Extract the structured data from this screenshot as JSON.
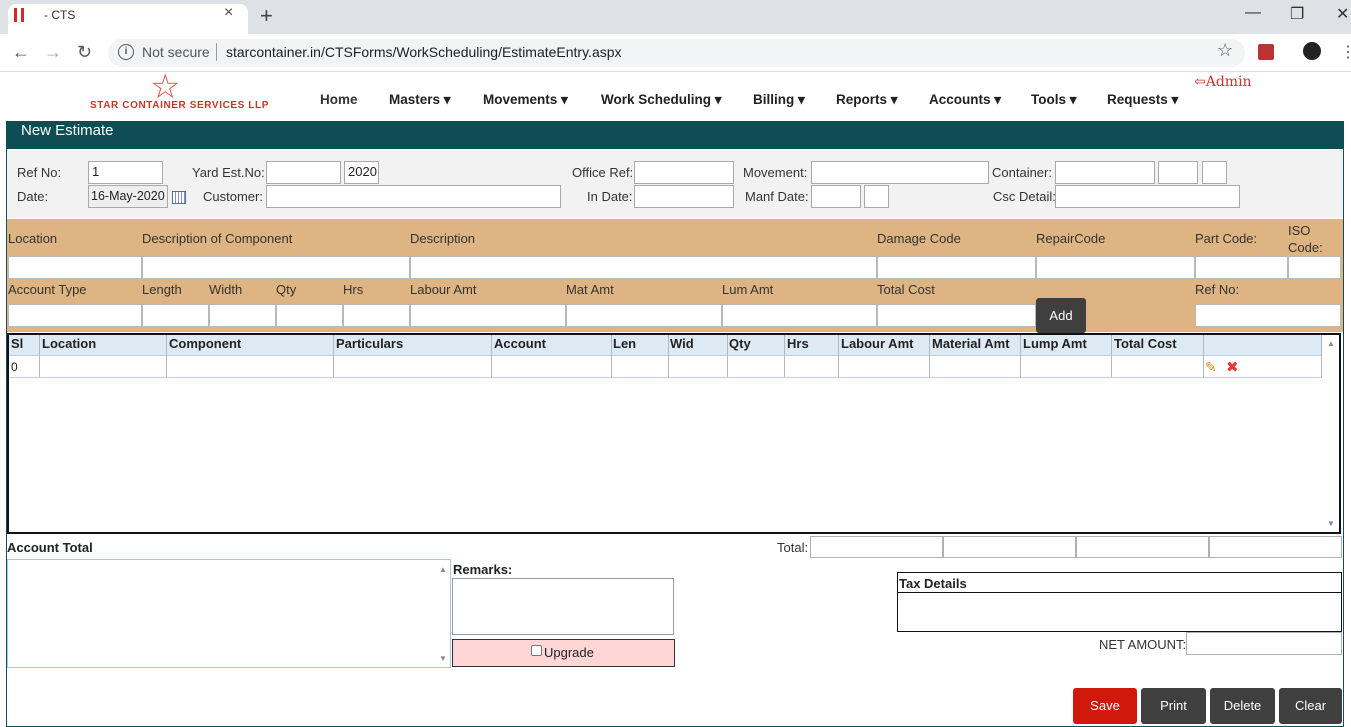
{
  "browser": {
    "tab_title": "- CTS",
    "tab_close": "×",
    "new_tab": "+",
    "security": "Not secure",
    "url": "starcontainer.in/CTSForms/WorkScheduling/EstimateEntry.aspx",
    "win_min": "—",
    "win_max": "❐",
    "win_close": "✕",
    "back": "←",
    "forward": "→",
    "reload": "↻",
    "star": "☆",
    "menu": "⋮"
  },
  "header": {
    "logo_text": "STAR CONTAINER SERVICES LLP",
    "logo_mark": "☆",
    "nav": [
      "Home",
      "Masters",
      "Movements",
      "Work Scheduling",
      "Billing",
      "Reports",
      "Accounts",
      "Tools",
      "Requests"
    ],
    "dropdown_caret": "▾",
    "admin_label": "Admin",
    "logout_icon": "⇦"
  },
  "panel": {
    "title": "New Estimate"
  },
  "form": {
    "ref_no_label": "Ref No:",
    "ref_no_value": "1",
    "yard_est_label": "Yard Est.No:",
    "yard_est_value": "",
    "year_value": "2020",
    "office_ref_label": "Office Ref:",
    "movement_label": "Movement:",
    "container_label": "Container:",
    "date_label": "Date:",
    "date_value": "16-May-2020",
    "customer_label": "Customer:",
    "in_date_label": "In Date:",
    "manf_date_label": "Manf Date:",
    "csc_detail_label": "Csc Detail:"
  },
  "entry": {
    "row1_labels": [
      "Location",
      "Description of Component",
      "Description",
      "Damage Code",
      "RepairCode",
      "Part Code:",
      "ISO Code:"
    ],
    "row2_labels": [
      "Account Type",
      "Length",
      "Width",
      "Qty",
      "Hrs",
      "Labour Amt",
      "Mat Amt",
      "Lum Amt",
      "Total Cost",
      "Ref No:"
    ],
    "add_label": "Add"
  },
  "grid": {
    "columns": [
      "Sl",
      "Location",
      "Component",
      "Particulars",
      "Account",
      "Len",
      "Wid",
      "Qty",
      "Hrs",
      "Labour Amt",
      "Material Amt",
      "Lump Amt",
      "Total Cost"
    ],
    "rows": [
      {
        "sl": "0"
      }
    ],
    "edit_icon": "✎",
    "delete_icon": "✖",
    "scroll_up": "▲",
    "scroll_down": "▼"
  },
  "bottom": {
    "account_total_label": "Account Total",
    "total_label": "Total:",
    "remarks_label": "Remarks:",
    "upgrade_label": "Upgrade",
    "tax_details_label": "Tax Details",
    "net_amount_label": "NET AMOUNT:"
  },
  "actions": {
    "save": "Save",
    "print": "Print",
    "delete": "Delete",
    "clear": "Clear"
  },
  "colors": {
    "panel_header": "#0f4d55",
    "tan_band": "#deb482",
    "save_button": "#d0180b",
    "dark_button": "#3f3f3f",
    "admin": "#d32f2f"
  }
}
